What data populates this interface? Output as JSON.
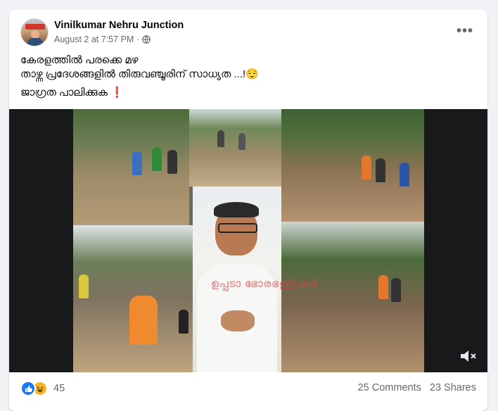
{
  "post": {
    "author": "Vinilkumar Nehru Junction",
    "date": "August 2 at 7:57 PM",
    "separator": "·",
    "privacy_icon": "globe-icon",
    "menu_icon": "more-options-icon",
    "more_label": "•••",
    "text_line1": "കേരളത്തിൽ പരക്കെ മഴ",
    "text_line2": "താഴ്ന്ന പ്രദേശങ്ങളിൽ തിരുവഞ്ചൂരിന് സാധ്യത ...!😌",
    "text_line3": "ജാഗ്രത പാലിക്കുക ❗"
  },
  "video": {
    "watermark": "ഉപ്പടാ ഭോരഭള്ളിക്കർ",
    "mute_icon": "volume-muted-icon"
  },
  "footer": {
    "reaction_icons": [
      "like-icon",
      "haha-icon"
    ],
    "reaction_count": "45",
    "comments": "25 Comments",
    "shares": "23 Shares"
  },
  "colors": {
    "brand_blue": "#1877f2",
    "haha_yellow": "#f7b125",
    "secondary_text": "#65676b",
    "page_bg": "#f0f2f5"
  }
}
